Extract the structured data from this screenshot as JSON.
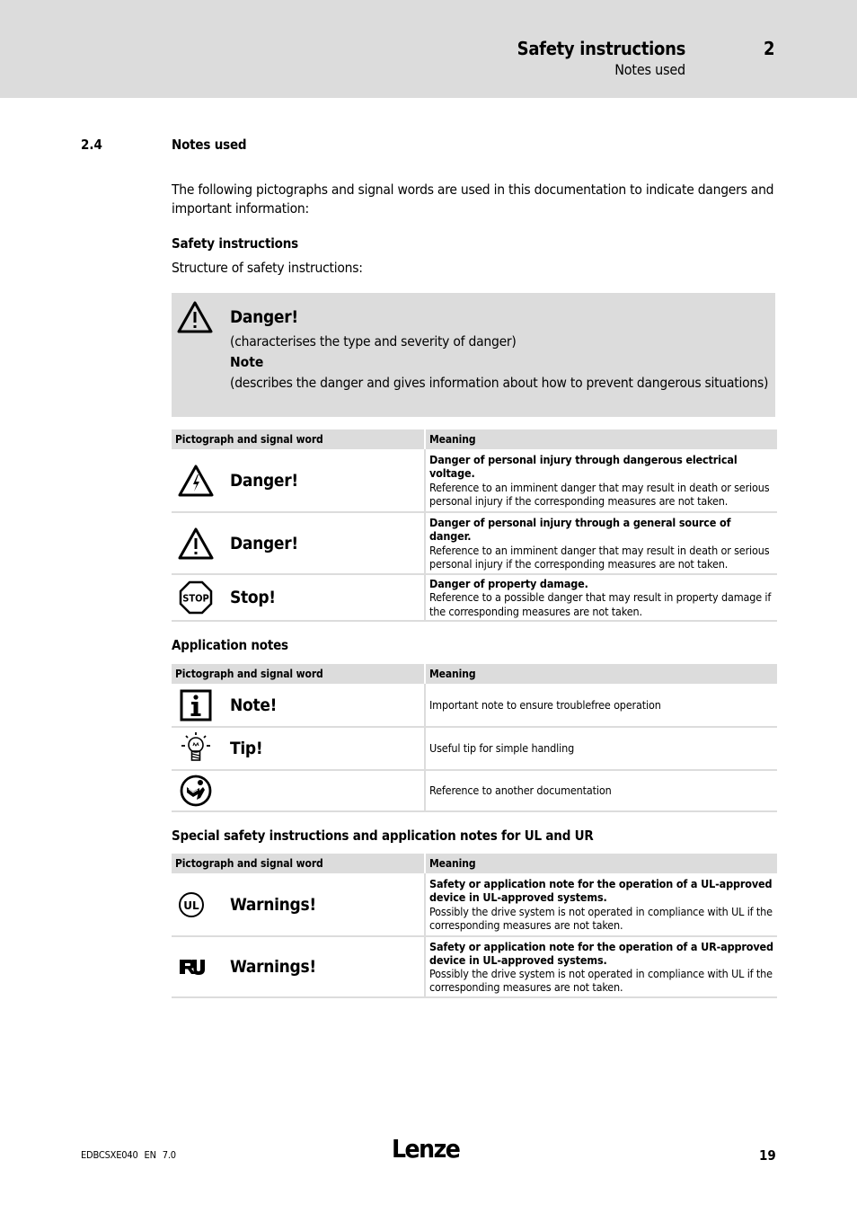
{
  "header": {
    "title": "Safety instructions",
    "chapter_number": "2",
    "subtitle": "Notes used"
  },
  "section": {
    "number": "2.4",
    "title": "Notes used"
  },
  "intro": "The following pictographs and signal words are used in this documentation to indicate dangers and important information:",
  "safety": {
    "heading": "Safety instructions",
    "structure_label": "Structure of safety instructions:",
    "example": {
      "icon": "warning-triangle-icon",
      "signal_word": "Danger!",
      "type_text": "(characterises the type and severity of danger)",
      "note_label": "Note",
      "note_text": "(describes the danger and gives information about how to prevent dangerous situations)"
    },
    "table": {
      "headers": [
        "Pictograph and signal word",
        "Meaning"
      ],
      "rows": [
        {
          "icon": "electrical-voltage-warning-icon",
          "signal_word": "Danger!",
          "meaning_title": "Danger of personal injury through dangerous electrical voltage.",
          "meaning_text": "Reference to an imminent danger that may result in death or serious personal injury if the corresponding measures are not taken."
        },
        {
          "icon": "general-danger-warning-icon",
          "signal_word": "Danger!",
          "meaning_title": "Danger of personal injury through a general source of danger.",
          "meaning_text": "Reference to an imminent danger that may result in death or serious personal injury if the corresponding measures are not taken."
        },
        {
          "icon": "stop-sign-icon",
          "signal_word": "Stop!",
          "meaning_title": "Danger of property damage.",
          "meaning_text": "Reference to a possible danger that may result in property damage if the corresponding measures are not taken."
        }
      ]
    }
  },
  "application": {
    "heading": "Application notes",
    "table": {
      "headers": [
        "Pictograph and signal word",
        "Meaning"
      ],
      "rows": [
        {
          "icon": "info-icon",
          "signal_word": "Note!",
          "meaning": "Important note to ensure troublefree operation"
        },
        {
          "icon": "lightbulb-icon",
          "signal_word": "Tip!",
          "meaning": "Useful tip for simple handling"
        },
        {
          "icon": "reference-book-icon",
          "signal_word": "",
          "meaning": "Reference to another documentation"
        }
      ]
    }
  },
  "ul": {
    "heading": "Special safety instructions and application notes for UL and UR",
    "table": {
      "headers": [
        "Pictograph and signal word",
        "Meaning"
      ],
      "rows": [
        {
          "icon": "ul-mark-icon",
          "signal_word": "Warnings!",
          "meaning_title": "Safety or application note for the operation of a UL-approved device in UL-approved systems.",
          "meaning_text": "Possibly the drive system is not operated in compliance with UL if the corresponding measures are not taken."
        },
        {
          "icon": "ur-mark-icon",
          "signal_word": "Warnings!",
          "meaning_title": "Safety or application note for the operation of a UR-approved device in UL-approved systems.",
          "meaning_text": "Possibly the drive system is not operated in compliance with UL if the corresponding measures are not taken."
        }
      ]
    }
  },
  "footer": {
    "doc_id": "EDBCSXE040  EN  7.0",
    "logo": "Lenze",
    "page_number": "19"
  }
}
